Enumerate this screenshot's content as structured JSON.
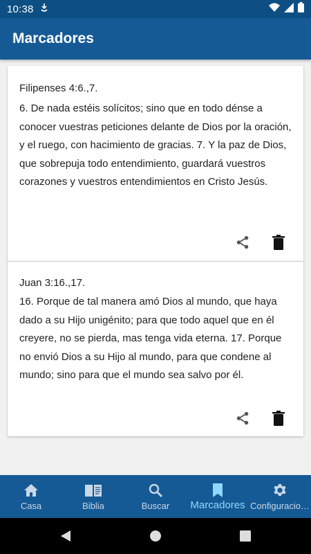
{
  "status_bar": {
    "time": "10:38",
    "icons": [
      "download-notification-icon",
      "wifi-icon",
      "signal-icon",
      "battery-icon"
    ]
  },
  "app_bar": {
    "title": "Marcadores"
  },
  "bookmarks": [
    {
      "reference": "Filipenses 4:6.,7.",
      "text": "6. De nada estéis solícitos; sino que en todo dénse a conocer vuestras peticiones delante de Dios por la oración, y el ruego, con hacimiento de gracias. 7. Y la paz de Dios, que sobrepuja todo entendimiento, guardará vuestros corazones y vuestros entendimientos en Cristo Jesús.",
      "actions": [
        "share-icon",
        "delete-icon"
      ]
    },
    {
      "reference": "Juan 3:16.,17.",
      "text": "16. Porque de tal manera amó Dios al mundo, que haya dado a su Hijo unigénito; para que todo aquel que en él creyere, no se pierda, mas tenga vida eterna. 17. Porque no envió Dios a su Hijo al mundo, para que condene al mundo; sino para que el mundo sea salvo por él.",
      "actions": [
        "share-icon",
        "delete-icon"
      ]
    }
  ],
  "bottom_nav": {
    "items": [
      {
        "label": "Casa",
        "icon": "home-icon",
        "active": false
      },
      {
        "label": "Biblia",
        "icon": "book-icon",
        "active": false
      },
      {
        "label": "Buscar",
        "icon": "search-icon",
        "active": false
      },
      {
        "label": "Marcadores",
        "icon": "bookmark-icon",
        "active": true
      },
      {
        "label": "Configuracio…",
        "icon": "gear-icon",
        "active": false
      }
    ]
  },
  "colors": {
    "status_bar": "#0d4f83",
    "app_bar": "#155a95",
    "nav_active": "#8fd8ff",
    "nav_inactive": "#c9d7e6"
  }
}
